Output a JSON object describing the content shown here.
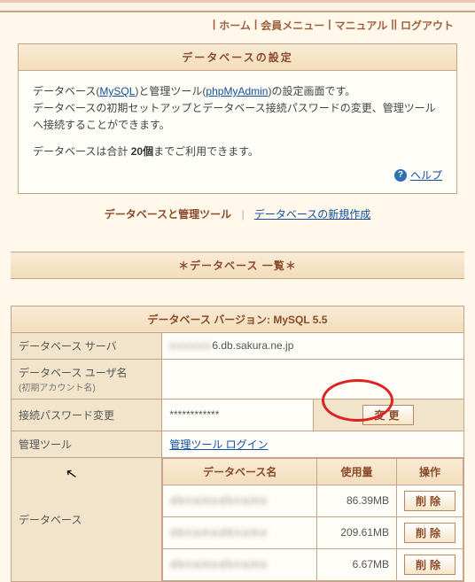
{
  "menu": {
    "home": "ホーム",
    "member": "会員メニュー",
    "manual": "マニュアル",
    "logout": "ログアウト",
    "pipe": " | "
  },
  "panel1": {
    "title": "データベースの設定",
    "line1a": "データベース(",
    "mysql": "MySQL",
    "line1b": ")と管理ツール(",
    "pma": "phpMyAdmin",
    "line1c": ")の設定画面です。",
    "line2": "データベースの初期セットアップとデータベース接続パスワードの変更、管理ツールへ接続することができます。",
    "line3a": "データベースは合計 ",
    "line3b": "20個",
    "line3c": "までご利用できます。",
    "help": "ヘルプ"
  },
  "subnav": {
    "a": "データベースと管理ツール",
    "b": "データベースの新規作成"
  },
  "band": "＊データベース 一覧＊",
  "grid": {
    "version_label": "データベース バージョン: MySQL 5.5",
    "server_label": "データベース サーバ",
    "server_value": "6.db.sakura.ne.jp",
    "user_label": "データベース ユーザ名",
    "user_sub": "(初期アカウント名)",
    "user_value": "　",
    "pw_label": "接続パスワード変更",
    "pw_value": "************",
    "pw_btn": "変更",
    "tool_label": "管理ツール",
    "tool_link": "管理ツール ログイン",
    "db_label": "データベース",
    "cols": {
      "name": "データベース名",
      "usage": "使用量",
      "ops": "操作"
    },
    "rows": [
      {
        "name": "",
        "usage": "86.39MB",
        "op": "削除"
      },
      {
        "name": "",
        "usage": "209.61MB",
        "op": "削除"
      },
      {
        "name": "",
        "usage": "6.67MB",
        "op": "削除"
      }
    ]
  }
}
